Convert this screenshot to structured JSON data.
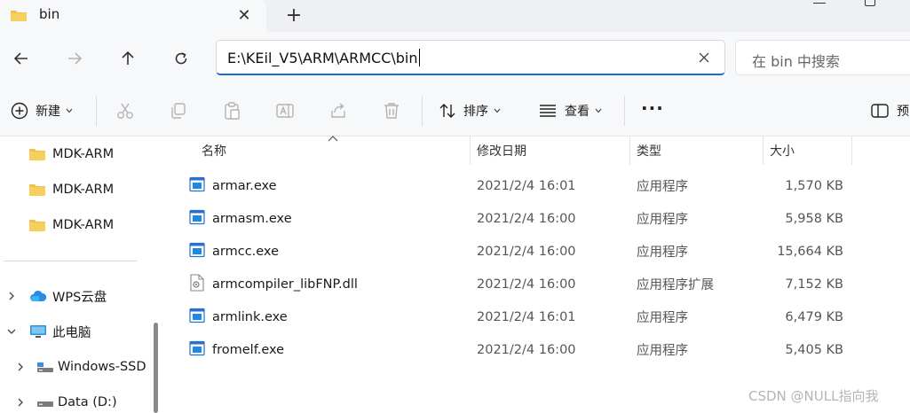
{
  "tab": {
    "title": "bin"
  },
  "address": {
    "path": "E:\\KEil_V5\\ARM\\ARMCC\\bin"
  },
  "search": {
    "placeholder": "在 bin 中搜索"
  },
  "toolbar": {
    "new_label": "新建",
    "sort_label": "排序",
    "view_label": "查看",
    "preview_label": "预"
  },
  "sidebar": {
    "items": [
      {
        "label": "MDK-ARM"
      },
      {
        "label": "MDK-ARM"
      },
      {
        "label": "MDK-ARM"
      },
      {
        "label": "WPS云盘"
      },
      {
        "label": "此电脑"
      },
      {
        "label": "Windows-SSD"
      },
      {
        "label": "Data (D:)"
      }
    ]
  },
  "columns": {
    "name": "名称",
    "modified": "修改日期",
    "type": "类型",
    "size": "大小"
  },
  "files": [
    {
      "name": "armar.exe",
      "modified": "2021/2/4 16:01",
      "type": "应用程序",
      "size": "1,570 KB",
      "icon": "exe-icon"
    },
    {
      "name": "armasm.exe",
      "modified": "2021/2/4 16:00",
      "type": "应用程序",
      "size": "5,958 KB",
      "icon": "exe-icon"
    },
    {
      "name": "armcc.exe",
      "modified": "2021/2/4 16:00",
      "type": "应用程序",
      "size": "15,664 KB",
      "icon": "exe-icon"
    },
    {
      "name": "armcompiler_libFNP.dll",
      "modified": "2021/2/4 16:00",
      "type": "应用程序扩展",
      "size": "7,152 KB",
      "icon": "dll-icon"
    },
    {
      "name": "armlink.exe",
      "modified": "2021/2/4 16:01",
      "type": "应用程序",
      "size": "6,479 KB",
      "icon": "exe-icon"
    },
    {
      "name": "fromelf.exe",
      "modified": "2021/2/4 16:00",
      "type": "应用程序",
      "size": "5,405 KB",
      "icon": "exe-icon"
    }
  ],
  "watermark": "CSDN @NULL指向我",
  "colors": {
    "accent": "#1b6bd1",
    "folder": "#f2c14b",
    "chrome": "#f7f8fa"
  }
}
